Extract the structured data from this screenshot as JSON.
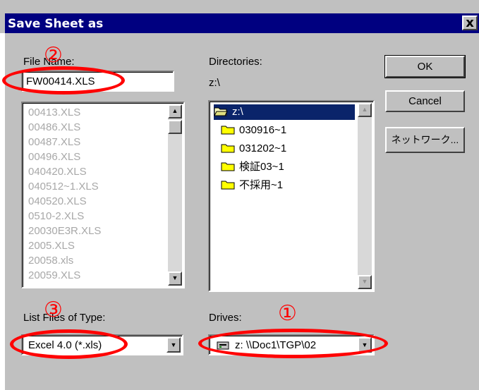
{
  "dialog": {
    "title": "Save Sheet as",
    "close_label": "x"
  },
  "file_name": {
    "label": "File Name:",
    "value": "FW00414.XLS",
    "files": [
      "00413.XLS",
      "00486.XLS",
      "00487.XLS",
      "00496.XLS",
      "040420.XLS",
      "040512~1.XLS",
      "040520.XLS",
      "0510-2.XLS",
      "20030E3R.XLS",
      "2005.XLS",
      "20058.xls",
      "20059.XLS"
    ]
  },
  "directories": {
    "label": "Directories:",
    "current_path": "z:\\",
    "items": [
      {
        "name": "z:\\",
        "icon": "open-folder-icon",
        "selected": true
      },
      {
        "name": "030916~1",
        "icon": "folder-icon"
      },
      {
        "name": "031202~1",
        "icon": "folder-icon"
      },
      {
        "name": "検証03~1",
        "icon": "folder-icon"
      },
      {
        "name": "不採用~1",
        "icon": "folder-icon"
      }
    ]
  },
  "buttons": {
    "ok": "OK",
    "cancel": "Cancel",
    "network": "ネットワーク..."
  },
  "file_type": {
    "label": "List Files of Type:",
    "value": "Excel 4.0 (*.xls)"
  },
  "drives": {
    "label": "Drives:",
    "value": "z: \\\\Doc1\\TGP\\02",
    "icon": "network-drive-icon"
  },
  "annotations": {
    "marker_1": "①",
    "marker_2": "②",
    "marker_3": "③",
    "color": "#ff0000"
  },
  "colors": {
    "titlebar": "#000080",
    "selection": "#0a246a",
    "face": "#c0c0c0"
  }
}
